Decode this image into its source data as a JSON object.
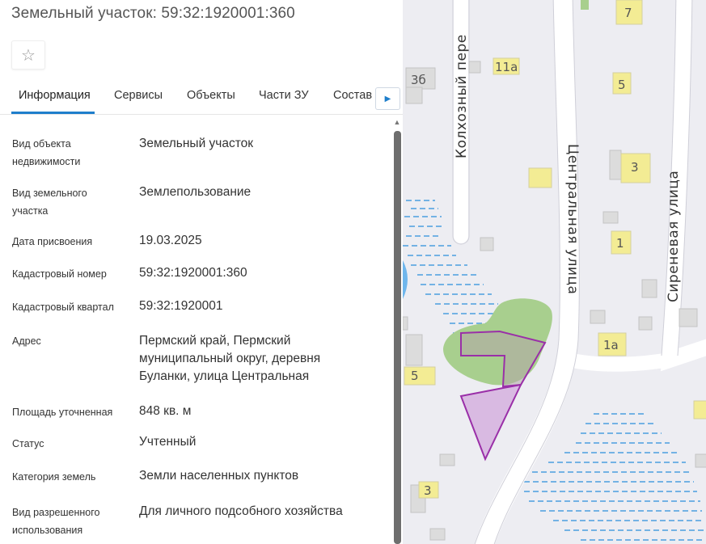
{
  "header": {
    "title": "Земельный участок: 59:32:1920001:360",
    "favorite_icon": "☆"
  },
  "tabs": [
    {
      "label": "Информация",
      "active": true
    },
    {
      "label": "Сервисы",
      "active": false
    },
    {
      "label": "Объекты",
      "active": false
    },
    {
      "label": "Части ЗУ",
      "active": false
    },
    {
      "label": "Состав",
      "active": false
    }
  ],
  "tab_scroll_icon": "▶",
  "scroll_up_icon": "▲",
  "info": [
    {
      "label": "Вид объекта недвижимости",
      "value": "Земельный участок"
    },
    {
      "label": "Вид земельного участка",
      "value": "Землепользование"
    },
    {
      "label": "Дата присвоения",
      "value": "19.03.2025"
    },
    {
      "label": "Кадастровый номер",
      "value": "59:32:1920001:360"
    },
    {
      "label": "Кадастровый квартал",
      "value": "59:32:1920001"
    },
    {
      "label": "Адрес",
      "value": "Пермский край, Пермский муниципальный округ, деревня Буланки, улица Центральная"
    },
    {
      "label": "Площадь уточненная",
      "value": "848 кв. м"
    },
    {
      "label": "Статус",
      "value": "Учтенный"
    },
    {
      "label": "Категория земель",
      "value": "Земли населенных пунктов"
    },
    {
      "label": "Вид разрешенного использования",
      "value": "Для личного подсобного хозяйства"
    }
  ],
  "map": {
    "street_labels": [
      "Колхозный пере",
      "Центральная улица",
      "Сиреневая улица"
    ],
    "house_numbers": [
      "7",
      "11а",
      "3б",
      "5",
      "3",
      "1",
      "1а",
      "5",
      "3"
    ],
    "colors": {
      "background": "#ededf2",
      "road": "#ffffff",
      "building": "#f3ec94",
      "building_outline": "#d4cfa0",
      "gray_building": "#dcdcdc",
      "forest": "#a8cf8e",
      "water": "#4b9fe0",
      "parcel_fill": "#c98fd6",
      "parcel_stroke": "#9a2fa8"
    }
  }
}
